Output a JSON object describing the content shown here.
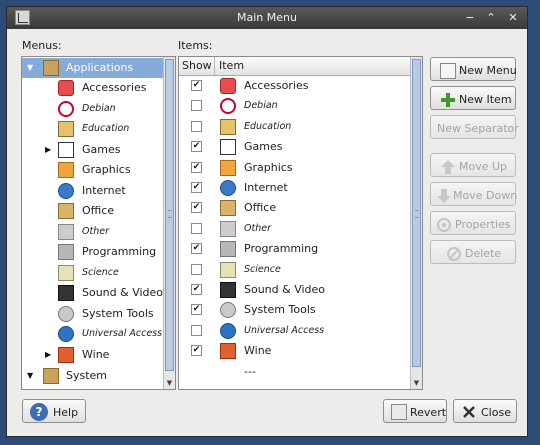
{
  "window": {
    "title": "Main Menu"
  },
  "menus": {
    "label": "Menus:",
    "root": {
      "label": "Applications",
      "expanded": true,
      "selected": true
    },
    "children": [
      {
        "label": "Accessories",
        "italic": false,
        "expander": false,
        "icon": "accessories-icon"
      },
      {
        "label": "Debian",
        "italic": true,
        "expander": false,
        "icon": "debian-icon"
      },
      {
        "label": "Education",
        "italic": true,
        "expander": false,
        "icon": "education-icon"
      },
      {
        "label": "Games",
        "italic": false,
        "expander": true,
        "icon": "games-icon"
      },
      {
        "label": "Graphics",
        "italic": false,
        "expander": false,
        "icon": "graphics-icon"
      },
      {
        "label": "Internet",
        "italic": false,
        "expander": false,
        "icon": "internet-icon"
      },
      {
        "label": "Office",
        "italic": false,
        "expander": false,
        "icon": "office-icon"
      },
      {
        "label": "Other",
        "italic": true,
        "expander": false,
        "icon": "other-icon"
      },
      {
        "label": "Programming",
        "italic": false,
        "expander": false,
        "icon": "programming-icon"
      },
      {
        "label": "Science",
        "italic": true,
        "expander": false,
        "icon": "science-icon"
      },
      {
        "label": "Sound & Video",
        "italic": false,
        "expander": false,
        "icon": "sound-video-icon"
      },
      {
        "label": "System Tools",
        "italic": false,
        "expander": false,
        "icon": "system-tools-icon"
      },
      {
        "label": "Universal Access",
        "italic": true,
        "expander": false,
        "icon": "universal-access-icon"
      },
      {
        "label": "Wine",
        "italic": false,
        "expander": true,
        "icon": "wine-icon"
      }
    ],
    "system": {
      "label": "System",
      "expanded": true
    }
  },
  "items": {
    "label": "Items:",
    "header": {
      "show": "Show",
      "item": "Item"
    },
    "rows": [
      {
        "label": "Accessories",
        "checked": true,
        "italic": false
      },
      {
        "label": "Debian",
        "checked": false,
        "italic": true
      },
      {
        "label": "Education",
        "checked": false,
        "italic": true
      },
      {
        "label": "Games",
        "checked": true,
        "italic": false
      },
      {
        "label": "Graphics",
        "checked": true,
        "italic": false
      },
      {
        "label": "Internet",
        "checked": true,
        "italic": false
      },
      {
        "label": "Office",
        "checked": true,
        "italic": false
      },
      {
        "label": "Other",
        "checked": false,
        "italic": true
      },
      {
        "label": "Programming",
        "checked": true,
        "italic": false
      },
      {
        "label": "Science",
        "checked": false,
        "italic": true
      },
      {
        "label": "Sound & Video",
        "checked": true,
        "italic": false
      },
      {
        "label": "System Tools",
        "checked": true,
        "italic": false
      },
      {
        "label": "Universal Access",
        "checked": false,
        "italic": true
      },
      {
        "label": "Wine",
        "checked": true,
        "italic": false
      },
      {
        "label": "---",
        "checked": null,
        "italic": false
      }
    ]
  },
  "buttons": {
    "new_menu": "New Menu",
    "new_item": "New Item",
    "new_separator": "New Separator",
    "move_up": "Move Up",
    "move_down": "Move Down",
    "properties": "Properties",
    "delete": "Delete",
    "help": "Help",
    "revert": "Revert",
    "close": "Close"
  },
  "colors": {
    "selection": "#86abd9",
    "titlebar": "#3f3f3f",
    "desktop": "#2c4b77"
  }
}
